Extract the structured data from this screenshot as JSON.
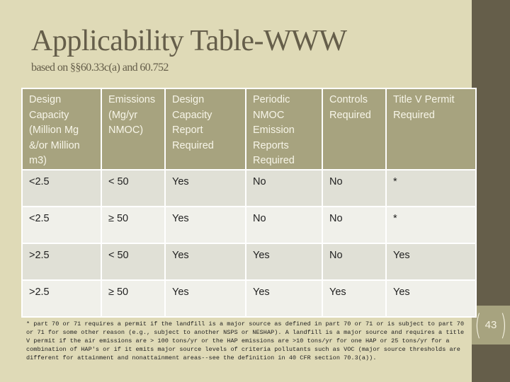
{
  "slide": {
    "title": "Applicability Table-WWW",
    "subtitle": "based on §§60.33c(a) and 60.752",
    "page_number": "43",
    "colors": {
      "background": "#dfdab7",
      "sidebar": "#655e4a",
      "header_fill": "#a7a37f",
      "row_odd": "#e0e0d6",
      "row_even": "#f0f0ea",
      "title_text": "#655e4a"
    }
  },
  "table": {
    "headers": [
      "Design Capacity (Million Mg &/or Million m3)",
      "Emissions (Mg/yr NMOC)",
      "Design Capacity Report Required",
      "Periodic NMOC Emission Reports Required",
      "Controls Required",
      "Title V Permit Required"
    ],
    "rows": [
      [
        "<2.5",
        "< 50",
        "Yes",
        "No",
        "No",
        "*"
      ],
      [
        "<2.5",
        "≥ 50",
        "Yes",
        "No",
        "No",
        "*"
      ],
      [
        ">2.5",
        "< 50",
        "Yes",
        "Yes",
        "No",
        "Yes"
      ],
      [
        ">2.5",
        "≥ 50",
        "Yes",
        "Yes",
        "Yes",
        "Yes"
      ]
    ]
  },
  "footnote": "* part 70 or 71 requires a permit if the landfill is a major source as defined in part 70 or 71 or is subject to part 70 or 71 for some other reason (e.g., subject to another NSPS or NESHAP). A landfill is a major source and requires a title V permit if the air emissions are > 100 tons/yr or the HAP emissions are >10 tons/yr for one HAP or 25 tons/yr for a combination of HAP's or if it emits major source levels of criteria pollutants such as VOC (major source thresholds are different for attainment and nonattainment areas--see the definition in 40 CFR section 70.3(a))."
}
